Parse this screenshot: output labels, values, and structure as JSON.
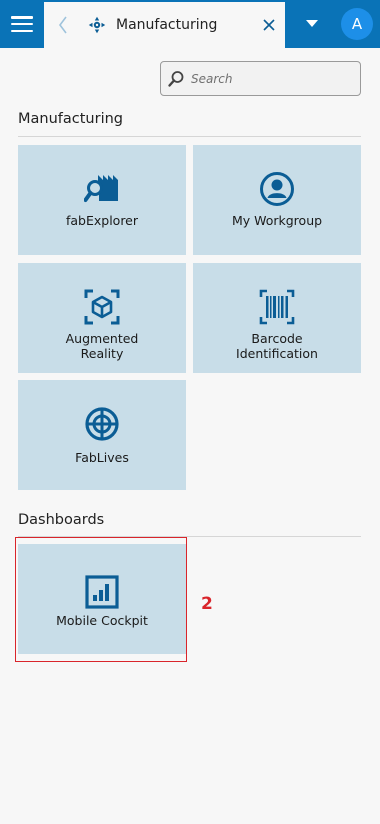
{
  "header": {
    "tab_title": "Manufacturing",
    "avatar_initial": "A",
    "colors": {
      "bar": "#0a73b7",
      "avatar": "#1d8fe8"
    },
    "icons": {
      "menu": "hamburger-icon",
      "back": "chevron-left-icon",
      "tab": "manufacturing-icon",
      "close": "close-icon",
      "dropdown": "caret-down-icon"
    }
  },
  "search": {
    "placeholder": "Search",
    "value": ""
  },
  "sections": {
    "manufacturing": {
      "title": "Manufacturing",
      "tiles": [
        {
          "label": "fabExplorer",
          "icon": "fab-explorer-icon"
        },
        {
          "label": "My Workgroup",
          "icon": "user-circle-icon"
        },
        {
          "label_line1": "Augmented",
          "label_line2": "Reality",
          "icon": "ar-cube-icon"
        },
        {
          "label_line1": "Barcode",
          "label_line2": "Identification",
          "icon": "barcode-icon"
        },
        {
          "label": "FabLives",
          "icon": "target-icon"
        }
      ]
    },
    "dashboards": {
      "title": "Dashboards",
      "tiles": [
        {
          "label": "Mobile Cockpit",
          "icon": "bar-chart-icon"
        }
      ]
    }
  },
  "annotation": {
    "marker": "2",
    "color": "#d9252b"
  },
  "tile_color": "#c8dde8",
  "icon_color": "#0b5d95"
}
